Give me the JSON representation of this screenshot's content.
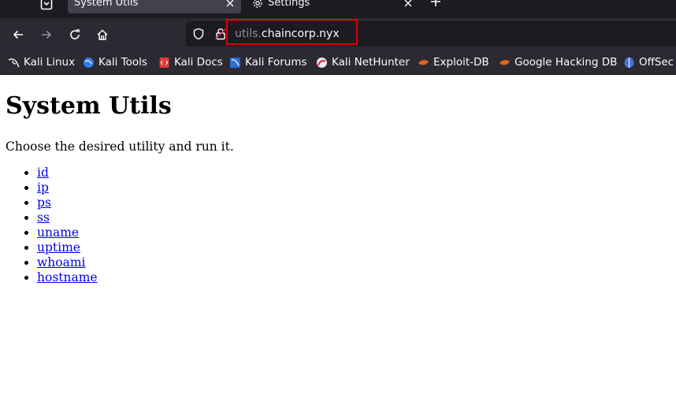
{
  "tabs": [
    {
      "title": "System Utils",
      "active": true
    },
    {
      "title": "Settings",
      "active": false
    }
  ],
  "url": {
    "subdomain": "utils.",
    "domain": "chaincorp.nyx"
  },
  "bookmarks": [
    {
      "label": "Kali Linux",
      "icon": "kali-dragon-icon"
    },
    {
      "label": "Kali Tools",
      "icon": "kali-tools-icon"
    },
    {
      "label": "Kali Docs",
      "icon": "kali-docs-icon"
    },
    {
      "label": "Kali Forums",
      "icon": "kali-forums-icon"
    },
    {
      "label": "Kali NetHunter",
      "icon": "kali-nethunter-icon"
    },
    {
      "label": "Exploit-DB",
      "icon": "exploit-db-icon"
    },
    {
      "label": "Google Hacking DB",
      "icon": "ghdb-icon"
    },
    {
      "label": "OffSec",
      "icon": "offsec-icon"
    }
  ],
  "page": {
    "title": "System Utils",
    "intro": "Choose the desired utility and run it.",
    "utilities": [
      "id",
      "ip",
      "ps",
      "ss",
      "uname",
      "uptime",
      "whoami",
      "hostname"
    ]
  },
  "colors": {
    "highlight": "#e00000",
    "link": "#0000ee",
    "toolbar": "#2b2a33",
    "tabstrip": "#1c1b22"
  }
}
